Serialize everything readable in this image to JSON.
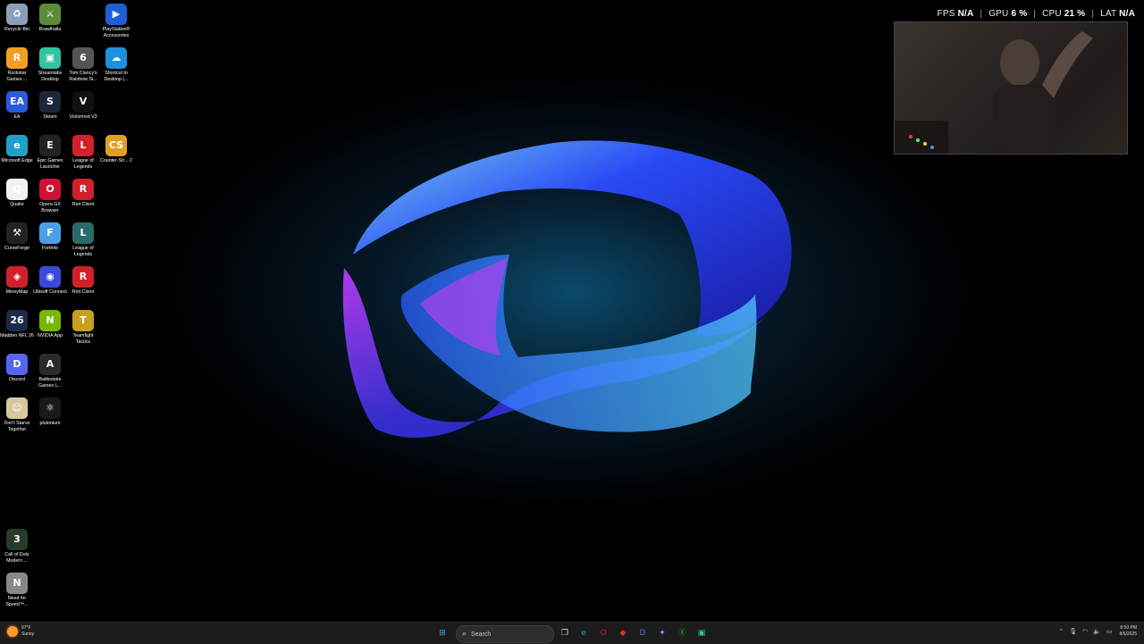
{
  "desktop_icons": [
    {
      "label": "Recycle Bin",
      "name": "recycle-bin-icon",
      "glyph": "♻",
      "color": "#8aa0b8",
      "col": 0,
      "row": 0
    },
    {
      "label": "Brawlhalla",
      "name": "brawlhalla-icon",
      "glyph": "⚔",
      "color": "#5a8a3a",
      "col": 1,
      "row": 0
    },
    {
      "label": "PlayStation® Accessories",
      "name": "playstation-accessories-icon",
      "glyph": "▶",
      "color": "#1f5fd6",
      "col": 3,
      "row": 0
    },
    {
      "label": "Rockstar Games ...",
      "name": "rockstar-games-icon",
      "glyph": "R",
      "color": "#f0a020",
      "col": 0,
      "row": 1
    },
    {
      "label": "Streamlabs Desktop",
      "name": "streamlabs-icon",
      "glyph": "▣",
      "color": "#31c3a2",
      "col": 1,
      "row": 1
    },
    {
      "label": "Tom Clancy's Rainbow Si...",
      "name": "rainbow-six-icon",
      "glyph": "6",
      "color": "#555",
      "col": 2,
      "row": 1
    },
    {
      "label": "Shortcut to Desktop (...",
      "name": "onedrive-shortcut-icon",
      "glyph": "☁",
      "color": "#1e90e0",
      "col": 3,
      "row": 1
    },
    {
      "label": "EA",
      "name": "ea-icon",
      "glyph": "EA",
      "color": "#2a5bd8",
      "col": 0,
      "row": 2
    },
    {
      "label": "Steam",
      "name": "steam-icon",
      "glyph": "S",
      "color": "#1b2838",
      "col": 1,
      "row": 2
    },
    {
      "label": "Voicemod V3",
      "name": "voicemod-icon",
      "glyph": "V",
      "color": "#111",
      "col": 2,
      "row": 2
    },
    {
      "label": "Microsoft Edge",
      "name": "edge-icon",
      "glyph": "e",
      "color": "#1fa0c8",
      "col": 0,
      "row": 3
    },
    {
      "label": "Epic Games Launcher",
      "name": "epic-games-icon",
      "glyph": "E",
      "color": "#222",
      "col": 1,
      "row": 3
    },
    {
      "label": "League of Legends",
      "name": "league-of-legends-icon",
      "glyph": "L",
      "color": "#d0202a",
      "col": 2,
      "row": 3
    },
    {
      "label": "Counter-Str... 2",
      "name": "counter-strike-icon",
      "glyph": "CS",
      "color": "#e0a020",
      "col": 3,
      "row": 3
    },
    {
      "label": "Quake",
      "name": "quake-icon",
      "glyph": "Q",
      "color": "#f2f2f2",
      "col": 0,
      "row": 4
    },
    {
      "label": "Opera GX Browser",
      "name": "opera-gx-icon",
      "glyph": "O",
      "color": "#d01030",
      "col": 1,
      "row": 4
    },
    {
      "label": "Riot Client",
      "name": "riot-client-icon",
      "glyph": "R",
      "color": "#d0202a",
      "col": 2,
      "row": 4
    },
    {
      "label": "CurseForge",
      "name": "curseforge-icon",
      "glyph": "⚒",
      "color": "#222",
      "col": 0,
      "row": 5
    },
    {
      "label": "Fortnite",
      "name": "fortnite-icon",
      "glyph": "F",
      "color": "#4aa0e8",
      "col": 1,
      "row": 5
    },
    {
      "label": "League of Legends",
      "name": "league-of-legends-icon",
      "glyph": "L",
      "color": "#2a6a6a",
      "col": 2,
      "row": 5
    },
    {
      "label": "MineyMap",
      "name": "mineymap-icon",
      "glyph": "◈",
      "color": "#d0202a",
      "col": 0,
      "row": 6
    },
    {
      "label": "Ubisoft Connect",
      "name": "ubisoft-connect-icon",
      "glyph": "◉",
      "color": "#3a4ad8",
      "col": 1,
      "row": 6
    },
    {
      "label": "Riot Client",
      "name": "riot-client-icon",
      "glyph": "R",
      "color": "#d0202a",
      "col": 2,
      "row": 6
    },
    {
      "label": "Madden NFL 26",
      "name": "madden-nfl-icon",
      "glyph": "26",
      "color": "#1a2a4a",
      "col": 0,
      "row": 7
    },
    {
      "label": "NVIDIA App",
      "name": "nvidia-app-icon",
      "glyph": "N",
      "color": "#76b900",
      "col": 1,
      "row": 7
    },
    {
      "label": "Teamfight Tactics",
      "name": "teamfight-tactics-icon",
      "glyph": "T",
      "color": "#c8a020",
      "col": 2,
      "row": 7
    },
    {
      "label": "Discord",
      "name": "discord-icon",
      "glyph": "D",
      "color": "#5865f2",
      "col": 0,
      "row": 8
    },
    {
      "label": "Battlestate Games L...",
      "name": "battlestate-games-icon",
      "glyph": "A",
      "color": "#2a2a2a",
      "col": 1,
      "row": 8
    },
    {
      "label": "Don't Starve Together",
      "name": "dont-starve-together-icon",
      "glyph": "☺",
      "color": "#d8c8a0",
      "col": 0,
      "row": 9
    },
    {
      "label": "plutonium",
      "name": "plutonium-icon",
      "glyph": "⚛",
      "color": "#1a1a1a",
      "col": 1,
      "row": 9
    },
    {
      "label": "Call of Duty Modern ...",
      "name": "call-of-duty-icon",
      "glyph": "3",
      "color": "#2a3a2a",
      "col": 0,
      "row": 12
    },
    {
      "label": "Need for Speed™...",
      "name": "need-for-speed-icon",
      "glyph": "N",
      "color": "#888",
      "col": 0,
      "row": 13
    }
  ],
  "perf_overlay": {
    "fps_label": "FPS",
    "fps_value": "N/A",
    "gpu_label": "GPU",
    "gpu_value": "6 %",
    "cpu_label": "CPU",
    "cpu_value": "21 %",
    "lat_label": "LAT",
    "lat_value": "N/A"
  },
  "taskbar": {
    "weather_temp": "97°F",
    "weather_desc": "Sunny",
    "search_placeholder": "Search",
    "time": "8:50 PM",
    "date": "8/6/2025",
    "apps": [
      {
        "name": "start-button-icon",
        "glyph": "⊞",
        "color": "#3aa0ff"
      },
      {
        "name": "task-view-icon",
        "glyph": "❐",
        "color": "#ddd"
      },
      {
        "name": "edge-taskbar-icon",
        "glyph": "e",
        "color": "#1fa0c8"
      },
      {
        "name": "opera-gx-taskbar-icon",
        "glyph": "O",
        "color": "#d01030"
      },
      {
        "name": "app-red-taskbar-icon",
        "glyph": "◆",
        "color": "#e03030"
      },
      {
        "name": "discord-taskbar-icon",
        "glyph": "D",
        "color": "#5865f2"
      },
      {
        "name": "copilot-taskbar-icon",
        "glyph": "✦",
        "color": "#c080ff"
      },
      {
        "name": "xbox-taskbar-icon",
        "glyph": "Ⓧ",
        "color": "#2ca02c"
      },
      {
        "name": "streamlabs-taskbar-icon",
        "glyph": "▣",
        "color": "#31c3a2"
      }
    ]
  }
}
